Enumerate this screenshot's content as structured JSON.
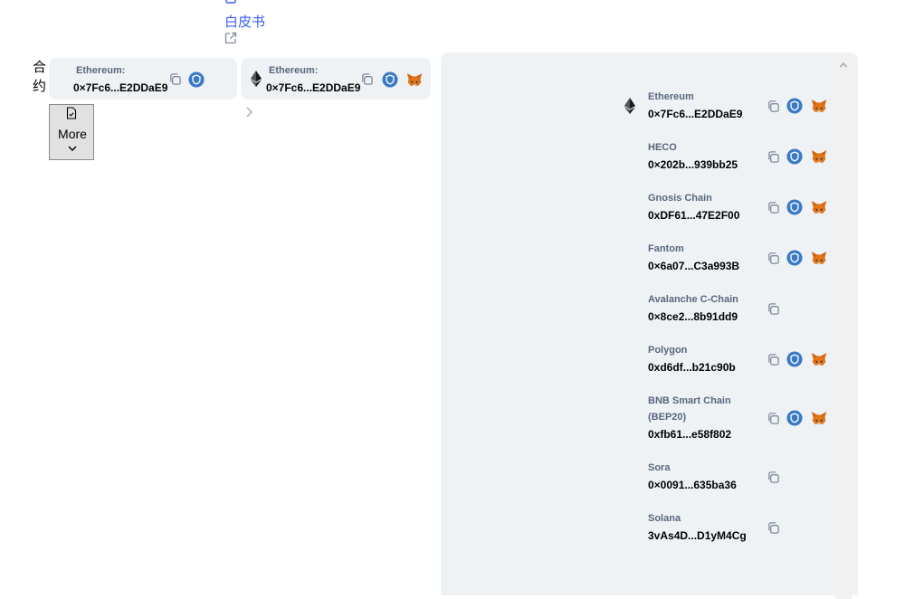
{
  "header": {
    "whitepaper_label": "白皮书",
    "whitepaper_icon": "document-icon",
    "external_link_icon": "external-link-icon"
  },
  "contracts": {
    "label": "合约",
    "cards": [
      {
        "chain": "Ethereum:",
        "address": "0×7Fc6...E2DDaE9",
        "icons": [
          "copy-icon",
          "shield-icon"
        ]
      },
      {
        "chain": "Ethereum:",
        "address": "0×7Fc6...E2DDaE9",
        "icons": [
          "ethereum-icon",
          "copy-icon",
          "shield-icon",
          "metamask-fox-icon"
        ]
      }
    ],
    "more_label": "More"
  },
  "dropdown": {
    "items": [
      {
        "chain": "Ethereum",
        "address": "0×7Fc6...E2DDaE9",
        "shield": true,
        "metamask": true,
        "eth_icon": true
      },
      {
        "chain": "HECO",
        "address": "0×202b...939bb25",
        "shield": true,
        "metamask": true
      },
      {
        "chain": "Gnosis Chain",
        "address": "0xDF61...47E2F00",
        "shield": true,
        "metamask": true
      },
      {
        "chain": "Fantom",
        "address": "0×6a07...C3a993B",
        "shield": true,
        "metamask": true
      },
      {
        "chain": "Avalanche C-Chain",
        "address": "0×8ce2...8b91dd9",
        "shield": false,
        "metamask": false
      },
      {
        "chain": "Polygon",
        "address": "0xd6df...b21c90b",
        "shield": true,
        "metamask": true
      },
      {
        "chain_line1": "BNB Smart Chain",
        "chain_line2": "(BEP20)",
        "address": "0xfb61...e58f802",
        "shield": true,
        "metamask": true
      },
      {
        "chain": "Sora",
        "address": "0×0091...635ba36",
        "shield": false,
        "metamask": false
      },
      {
        "chain": "Solana",
        "address": "3vAs4D...D1yM4Cg",
        "shield": false,
        "metamask": false
      }
    ]
  },
  "colors": {
    "link": "#3861fb",
    "card_bg": "#eff2f5",
    "shield": "#3a79c6",
    "label_gray": "#58667e"
  }
}
